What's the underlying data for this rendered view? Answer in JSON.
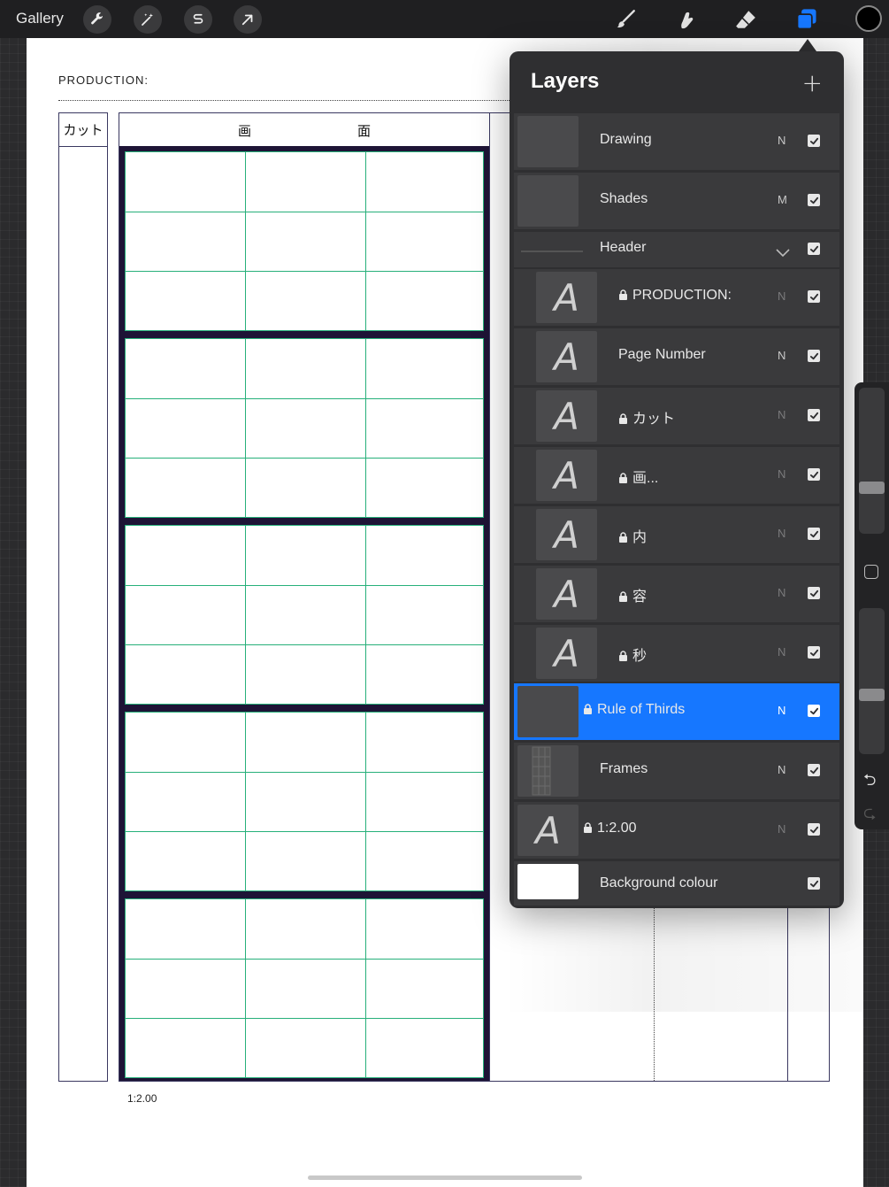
{
  "toolbar": {
    "gallery_label": "Gallery",
    "left_tools": [
      "wrench-icon",
      "magic-wand-icon",
      "selection-s-icon",
      "transform-arrow-icon"
    ],
    "right_tools": [
      "brush-icon",
      "smudge-icon",
      "eraser-icon",
      "layers-icon"
    ],
    "accent_color": "#1677ff",
    "current_color": "#000000"
  },
  "canvas": {
    "production_label": "PRODUCTION:",
    "cut_header": "カット",
    "screen_header_left": "画",
    "screen_header_right": "面",
    "ratio_label": "1:2.00",
    "frame_line_color": "#27b07a",
    "frame_border_color": "#1e1436"
  },
  "layers_panel": {
    "title": "Layers",
    "add_label": "+",
    "layers": [
      {
        "name": "Drawing",
        "blend": "N",
        "locked": false,
        "visible": true,
        "thumb": "blank",
        "child": false,
        "active": false
      },
      {
        "name": "Shades",
        "blend": "M",
        "locked": false,
        "visible": true,
        "thumb": "blank",
        "child": false,
        "active": false
      },
      {
        "name": "Header",
        "blend": "",
        "locked": false,
        "visible": true,
        "thumb": "group",
        "child": false,
        "active": false,
        "expanded": true
      },
      {
        "name": "PRODUCTION:",
        "blend": "N",
        "locked": true,
        "visible": true,
        "thumb": "text",
        "child": true,
        "active": false
      },
      {
        "name": "Page Number",
        "blend": "N",
        "locked": false,
        "visible": true,
        "thumb": "text",
        "child": true,
        "active": false
      },
      {
        "name": "カット",
        "blend": "N",
        "locked": true,
        "visible": true,
        "thumb": "text",
        "child": true,
        "active": false
      },
      {
        "name": "画...",
        "blend": "N",
        "locked": true,
        "visible": true,
        "thumb": "text",
        "child": true,
        "active": false
      },
      {
        "name": "内",
        "blend": "N",
        "locked": true,
        "visible": true,
        "thumb": "text",
        "child": true,
        "active": false
      },
      {
        "name": "容",
        "blend": "N",
        "locked": true,
        "visible": true,
        "thumb": "text",
        "child": true,
        "active": false
      },
      {
        "name": "秒",
        "blend": "N",
        "locked": true,
        "visible": true,
        "thumb": "text",
        "child": true,
        "active": false
      },
      {
        "name": "Rule of Thirds",
        "blend": "N",
        "locked": true,
        "visible": true,
        "thumb": "blank",
        "child": false,
        "active": true
      },
      {
        "name": "Frames",
        "blend": "N",
        "locked": false,
        "visible": true,
        "thumb": "frames",
        "child": false,
        "active": false
      },
      {
        "name": "1:2.00",
        "blend": "N",
        "locked": true,
        "visible": true,
        "thumb": "text",
        "child": false,
        "active": false
      },
      {
        "name": "Background colour",
        "blend": "",
        "locked": false,
        "visible": true,
        "thumb": "white",
        "child": false,
        "active": false
      }
    ]
  },
  "sidebar": {
    "undo_icon": "undo-icon",
    "redo_icon": "redo-icon",
    "brush_size_level": 0.3,
    "opacity_level": 0.4
  }
}
